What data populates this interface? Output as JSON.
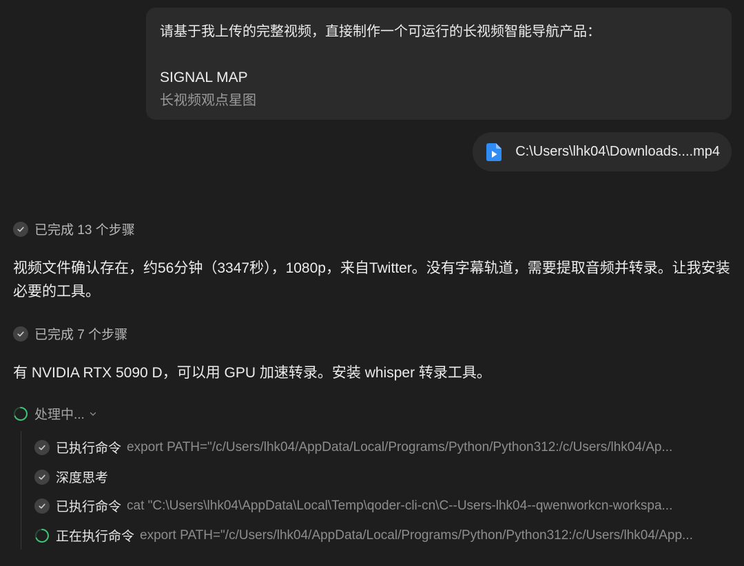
{
  "user_message": {
    "line1": "请基于我上传的完整视频，直接制作一个可运行的长视频智能导航产品：",
    "line2": "SIGNAL MAP",
    "line3": "长视频观点星图"
  },
  "attachment": {
    "icon": "video-file-icon",
    "filename": "C:\\Users\\lhk04\\Downloads....mp4"
  },
  "steps": [
    {
      "label": "已完成 13 个步骤"
    },
    {
      "label": "已完成 7 个步骤"
    }
  ],
  "messages": [
    "视频文件确认存在，约56分钟（3347秒），1080p，来自Twitter。没有字幕轨道，需要提取音频并转录。让我安装必要的工具。",
    "有 NVIDIA RTX 5090 D，可以用 GPU 加速转录。安装 whisper 转录工具。"
  ],
  "processing": {
    "label": "处理中..."
  },
  "actions": [
    {
      "label": "已执行命令",
      "detail": "export PATH=\"/c/Users/lhk04/AppData/Local/Programs/Python/Python312:/c/Users/lhk04/Ap...",
      "status": "done"
    },
    {
      "label": "深度思考",
      "detail": "",
      "status": "done"
    },
    {
      "label": "已执行命令",
      "detail": "cat \"C:\\Users\\lhk04\\AppData\\Local\\Temp\\qoder-cli-cn\\C--Users-lhk04--qwenworkcn-workspa...",
      "status": "done"
    },
    {
      "label": "正在执行命令",
      "detail": "export PATH=\"/c/Users/lhk04/AppData/Local/Programs/Python/Python312:/c/Users/lhk04/App...",
      "status": "running"
    }
  ],
  "colors": {
    "background": "#1e1e1e",
    "bubble": "#2b2b2b",
    "accent_green": "#3ec27a",
    "file_icon_blue": "#2f8cf4"
  }
}
